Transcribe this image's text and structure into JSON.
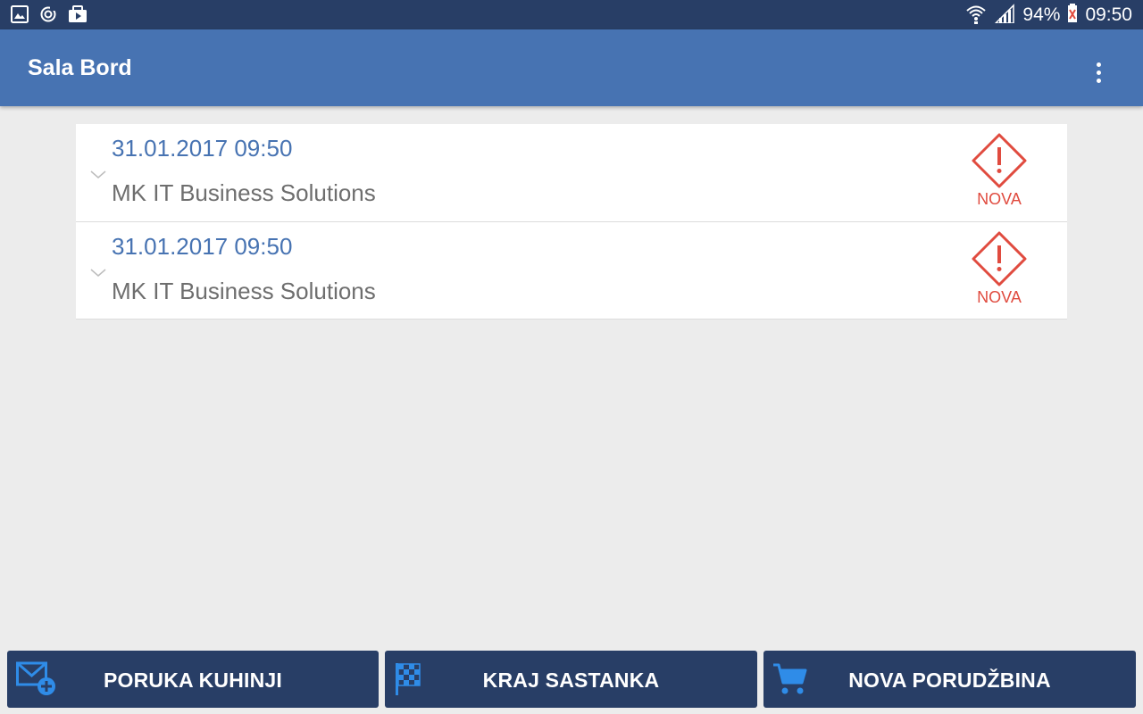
{
  "status_bar": {
    "battery": "94%",
    "time": "09:50",
    "icons": [
      "gallery-icon",
      "sync-icon",
      "media-icon",
      "wifi-icon",
      "signal-icon",
      "battery-icon"
    ]
  },
  "app_bar": {
    "title": "Sala Bord",
    "menu_icon": "more-vert-icon"
  },
  "orders": [
    {
      "datetime": "31.01.2017 09:50",
      "client": "MK IT Business Solutions",
      "status": "NOVA",
      "status_icon": "warning-diamond-icon"
    },
    {
      "datetime": "31.01.2017 09:50",
      "client": "MK IT Business Solutions",
      "status": "NOVA",
      "status_icon": "warning-diamond-icon"
    }
  ],
  "actions": [
    {
      "label": "PORUKA KUHINJI",
      "icon": "mail-add-icon"
    },
    {
      "label": "KRAJ SASTANKA",
      "icon": "checkered-flag-icon"
    },
    {
      "label": "NOVA PORUDŽBINA",
      "icon": "shopping-cart-icon"
    }
  ],
  "colors": {
    "status_bar": "#283e66",
    "app_bar": "#4773b2",
    "accent_blue": "#4773b2",
    "icon_blue": "#2f8ce8",
    "status_red": "#e04b3f",
    "background": "#ececec"
  }
}
